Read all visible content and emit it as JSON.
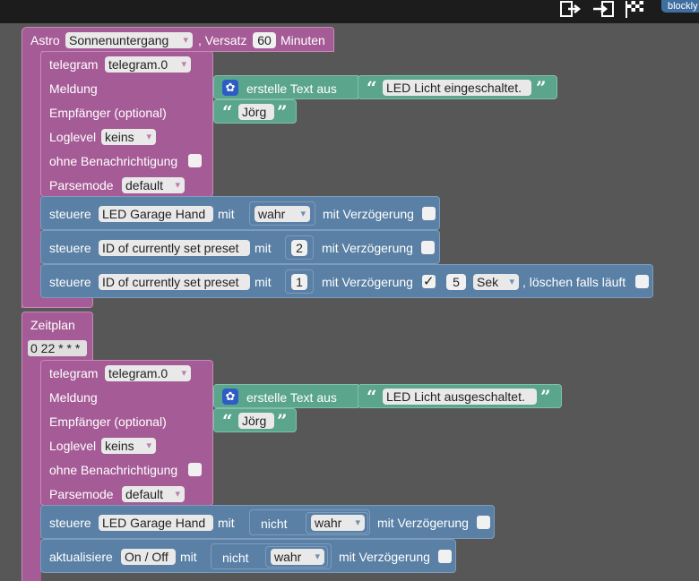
{
  "toolbar": {
    "export_icon": "export-icon",
    "import_icon": "import-icon",
    "flag_icon": "checkered-flag-icon",
    "badge_text": "blockly"
  },
  "astro": {
    "label": "Astro",
    "event": "Sonnenuntergang",
    "offset_label": ", Versatz",
    "offset_value": "60",
    "minutes_label": "Minuten"
  },
  "telegram1": {
    "label": "telegram",
    "instance": "telegram.0",
    "message_label": "Meldung",
    "text_block_label": "erstelle Text aus",
    "message_text": "LED Licht eingeschaltet.",
    "recipient_label": "Empfänger (optional)",
    "recipient_value": "Jörg",
    "loglevel_label": "Loglevel",
    "loglevel_value": "keins",
    "silent_label": "ohne Benachrichtigung",
    "parsemode_label": "Parsemode",
    "parsemode_value": "default"
  },
  "control1": {
    "verb": "steuere",
    "target": "LED Garage Hand",
    "with_label": "mit",
    "value": "wahr",
    "delay_label": "mit Verzögerung"
  },
  "control2": {
    "verb": "steuere",
    "target": "ID of currently set preset",
    "with_label": "mit",
    "value": "2",
    "delay_label": "mit Verzögerung"
  },
  "control3": {
    "verb": "steuere",
    "target": "ID of currently set preset",
    "with_label": "mit",
    "value": "1",
    "delay_label": "mit Verzögerung",
    "delay_value": "5",
    "delay_unit": "Sek",
    "clear_label": ", löschen falls läuft"
  },
  "schedule": {
    "label": "Zeitplan",
    "cron": "0 22 * * *"
  },
  "telegram2": {
    "label": "telegram",
    "instance": "telegram.0",
    "message_label": "Meldung",
    "text_block_label": "erstelle Text aus",
    "message_text": "LED Licht ausgeschaltet.",
    "recipient_label": "Empfänger (optional)",
    "recipient_value": "Jörg",
    "loglevel_label": "Loglevel",
    "loglevel_value": "keins",
    "silent_label": "ohne Benachrichtigung",
    "parsemode_label": "Parsemode",
    "parsemode_value": "default"
  },
  "control4": {
    "verb": "steuere",
    "target": "LED Garage Hand",
    "with_label": "mit",
    "not_label": "nicht",
    "value": "wahr",
    "delay_label": "mit Verzögerung"
  },
  "update1": {
    "verb": "aktualisiere",
    "target": "On / Off",
    "with_label": "mit",
    "not_label": "nicht",
    "value": "wahr",
    "delay_label": "mit Verzögerung"
  },
  "colors": {
    "event_block": "#a55b96",
    "action_block": "#5a80a5",
    "text_block": "#5ba58c",
    "workspace": "#575757",
    "toolbar": "#1c1c1c"
  }
}
